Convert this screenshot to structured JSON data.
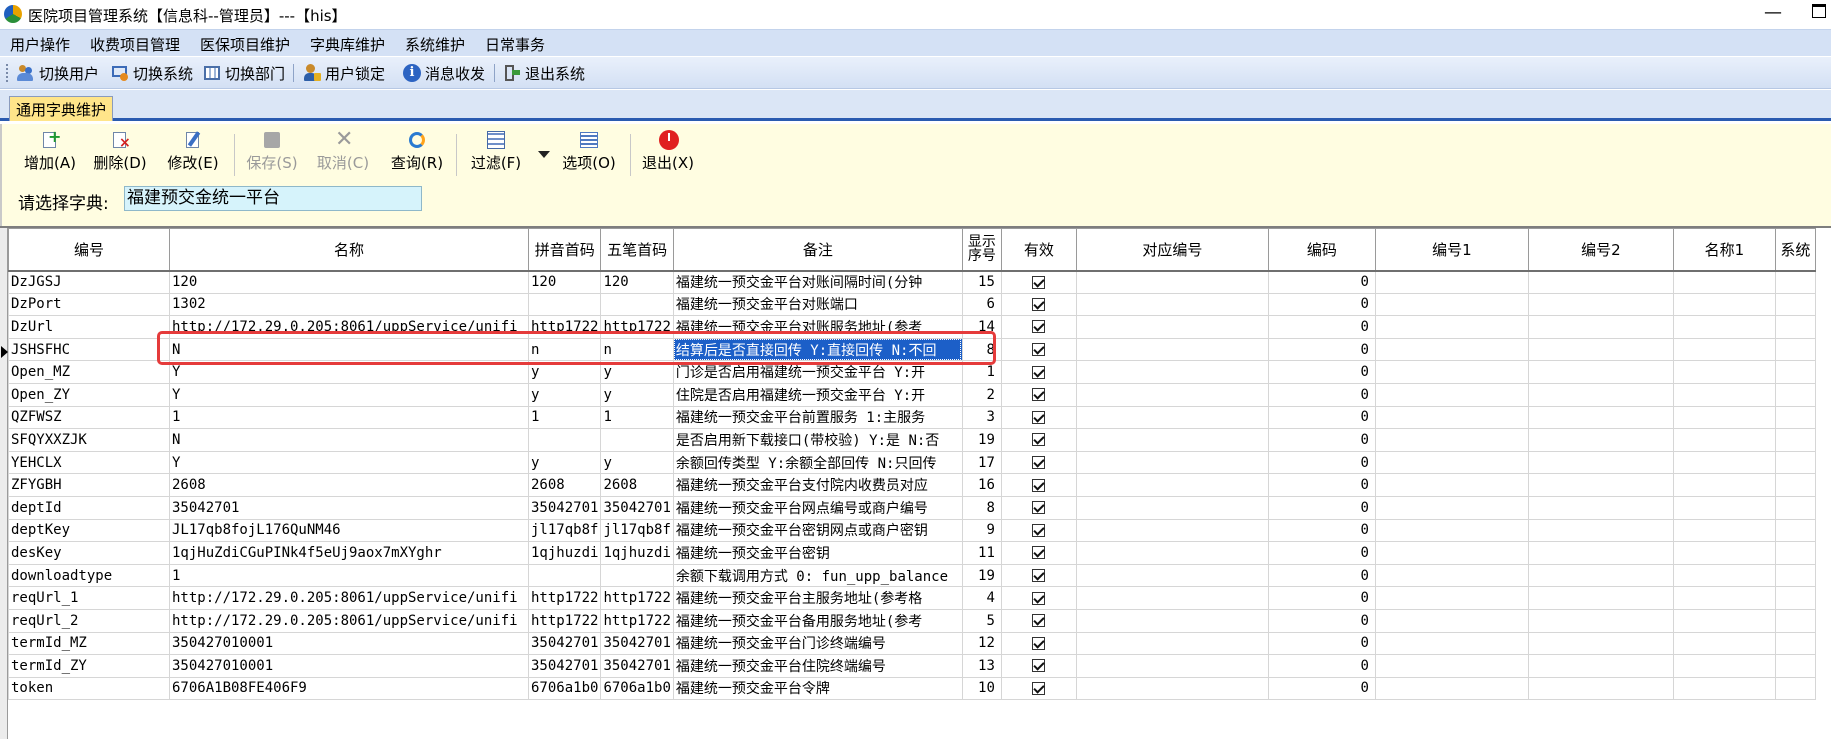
{
  "window": {
    "title": "医院项目管理系统【信息科--管理员】---【his】",
    "minimize_glyph": "—"
  },
  "menubar": {
    "items": [
      "用户操作",
      "收费项目管理",
      "医保项目维护",
      "字典库维护",
      "系统维护",
      "日常事务"
    ]
  },
  "toolbar": {
    "items": [
      {
        "label": "切换用户",
        "icon": "users-icon"
      },
      {
        "label": "切换系统",
        "icon": "switch-system-icon"
      },
      {
        "label": "切换部门",
        "icon": "department-icon"
      },
      {
        "label": "用户锁定",
        "icon": "user-lock-icon"
      },
      {
        "label": "消息收发",
        "icon": "info-message-icon"
      },
      {
        "label": "退出系统",
        "icon": "exit-system-icon"
      }
    ]
  },
  "tab": {
    "label": "通用字典维护"
  },
  "actions": {
    "add": "增加(A)",
    "delete": "删除(D)",
    "edit": "修改(E)",
    "save": "保存(S)",
    "cancel": "取消(C)",
    "query": "查询(R)",
    "filter": "过滤(F)",
    "options": "选项(O)",
    "exit": "退出(X)"
  },
  "dictionary": {
    "label": "请选择字典:",
    "value": "福建预交金统一平台"
  },
  "grid": {
    "columns": [
      "编号",
      "名称",
      "拼音首码",
      "五笔首码",
      "备注",
      "显示序号",
      "有效",
      "对应编号",
      "编码",
      "编号1",
      "编号2",
      "名称1",
      "系统"
    ],
    "selected_row_index": 3,
    "rows": [
      [
        "DzJGSJ",
        "120",
        "120",
        "120",
        "福建统一预交金平台对账间隔时间(分钟",
        "15",
        true,
        "",
        "0"
      ],
      [
        "DzPort",
        "1302",
        "",
        "",
        "福建统一预交金平台对账端口",
        "6",
        true,
        "",
        "0"
      ],
      [
        "DzUrl",
        "http://172.29.0.205:8061/uppService/unifi",
        "http1722",
        "http1722",
        "福建统一预交金平台对账服务地址(参考",
        "14",
        true,
        "",
        "0"
      ],
      [
        "JSHSFHC",
        "N",
        "n",
        "n",
        "结算后是否直接回传 Y:直接回传 N:不回",
        "8",
        true,
        "",
        "0"
      ],
      [
        "Open_MZ",
        "Y",
        "y",
        "y",
        "门诊是否启用福建统一预交金平台 Y:开",
        "1",
        true,
        "",
        "0"
      ],
      [
        "Open_ZY",
        "Y",
        "y",
        "y",
        "住院是否启用福建统一预交金平台 Y:开",
        "2",
        true,
        "",
        "0"
      ],
      [
        "QZFWSZ",
        "1",
        "1",
        "1",
        "福建统一预交金平台前置服务 1:主服务",
        "3",
        true,
        "",
        "0"
      ],
      [
        "SFQYXXZJK",
        "N",
        "",
        "",
        "是否启用新下载接口(带校验) Y:是 N:否",
        "19",
        true,
        "",
        "0"
      ],
      [
        "YEHCLX",
        "Y",
        "y",
        "y",
        "余额回传类型 Y:余额全部回传 N:只回传",
        "17",
        true,
        "",
        "0"
      ],
      [
        "ZFYGBH",
        "2608",
        "2608",
        "2608",
        "福建统一预交金平台支付院内收费员对应",
        "16",
        true,
        "",
        "0"
      ],
      [
        "deptId",
        "35042701",
        "35042701",
        "35042701",
        "福建统一预交金平台网点编号或商户编号",
        "8",
        true,
        "",
        "0"
      ],
      [
        "deptKey",
        "JL17qb8fojL176QuNM46",
        "jl17qb8f",
        "jl17qb8f",
        "福建统一预交金平台密钥网点或商户密钥",
        "9",
        true,
        "",
        "0"
      ],
      [
        "desKey",
        "1qjHuZdiCGuPINk4f5eUj9aox7mXYghr",
        "1qjhuzdi",
        "1qjhuzdi",
        "福建统一预交金平台密钥",
        "11",
        true,
        "",
        "0"
      ],
      [
        "downloadtype",
        "1",
        "",
        "",
        "余额下载调用方式 0: fun_upp_balance",
        "19",
        true,
        "",
        "0"
      ],
      [
        "reqUrl_1",
        "http://172.29.0.205:8061/uppService/unifi",
        "http1722",
        "http1722",
        "福建统一预交金平台主服务地址(参考格",
        "4",
        true,
        "",
        "0"
      ],
      [
        "reqUrl_2",
        "http://172.29.0.205:8061/uppService/unifi",
        "http1722",
        "http1722",
        "福建统一预交金平台备用服务地址(参考",
        "5",
        true,
        "",
        "0"
      ],
      [
        "termId_MZ",
        "350427010001",
        "35042701",
        "35042701",
        "福建统一预交金平台门诊终端编号",
        "12",
        true,
        "",
        "0"
      ],
      [
        "termId_ZY",
        "350427010001",
        "35042701",
        "35042701",
        "福建统一预交金平台住院终端编号",
        "13",
        true,
        "",
        "0"
      ],
      [
        "token",
        "6706A1B08FE406F9",
        "6706a1b0",
        "6706a1b0",
        "福建统一预交金平台令牌",
        "10",
        true,
        "",
        "0"
      ]
    ]
  },
  "colors": {
    "menubar_bg": "#d4e1f5",
    "tab_active_bg": "#ffe58a",
    "ribbon_bg": "#fffde1",
    "dict_input_bg": "#d6f3fb",
    "selection_bg": "#1c5fc8",
    "highlight_border": "#e53b3b",
    "exit_icon": "#e02020"
  }
}
